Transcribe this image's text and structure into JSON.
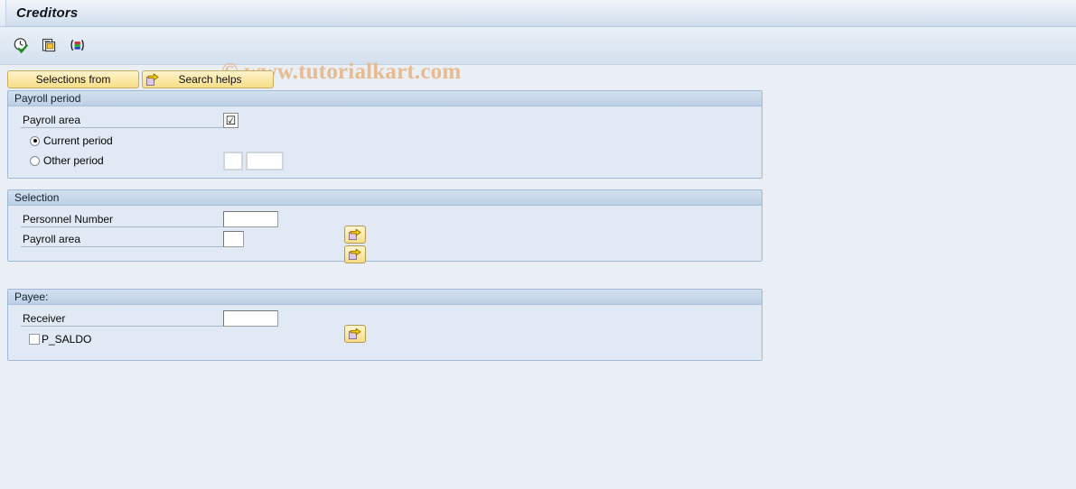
{
  "window": {
    "title": "Creditors"
  },
  "watermark": {
    "text": "© www.tutorialkart.com"
  },
  "toolbar": {
    "icons": [
      {
        "name": "execute-clock-icon",
        "title": "Execute"
      },
      {
        "name": "copy-variant-icon",
        "title": "Get Variant"
      },
      {
        "name": "color-legend-icon",
        "title": "Legend"
      }
    ]
  },
  "buttons": {
    "selections_from": "Selections from",
    "search_helps": "Search helps",
    "search_helps_icon": "yellow-arrow-document-icon"
  },
  "sections": [
    {
      "id": "payroll-period",
      "title": "Payroll period",
      "payroll_area_label": "Payroll area",
      "payroll_area_value": "☑",
      "current_period_label": "Current period",
      "current_period_selected": true,
      "other_period_label": "Other period",
      "other_period_selected": false,
      "other_period_value_1": "",
      "other_period_value_2": ""
    },
    {
      "id": "selection",
      "title": "Selection",
      "rows": [
        {
          "label": "Personnel Number",
          "value": "",
          "has_multi_select": true
        },
        {
          "label": "Payroll area",
          "value": "",
          "has_multi_select": true
        }
      ]
    },
    {
      "id": "payee",
      "title": "Payee:",
      "receiver_label": "Receiver",
      "receiver_value": "",
      "checkbox_label": "P_SALDO",
      "checkbox_checked": false
    }
  ],
  "colors": {
    "page_background": "#eaeff6",
    "panel_background": "#e1eaf4",
    "panel_header": "#c6d7e9",
    "panel_border": "#9fb9d4",
    "button_yellow": "#fbe9a8",
    "watermark": "#e7b98a",
    "arrow_yellow": "#ffcc00"
  }
}
